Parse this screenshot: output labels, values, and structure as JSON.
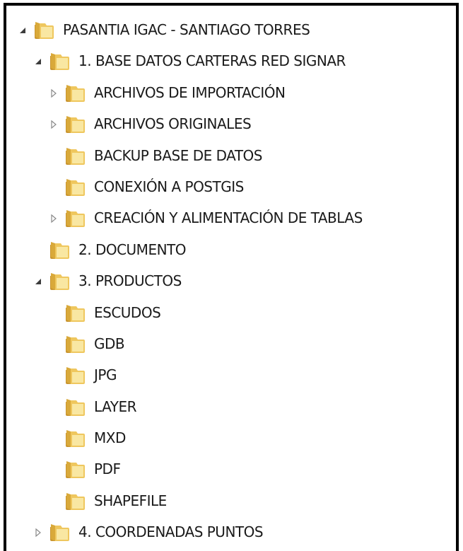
{
  "colors": {
    "folder_light": "#F9E7A2",
    "folder_mid": "#EFC75E",
    "folder_dark": "#D9A93A",
    "folder_tab": "#C99530",
    "expander_open": "#3C3C3C",
    "expander_closed": "#8A8A8A",
    "text": "#1A1A1A"
  },
  "tree": {
    "root": {
      "label": "PASANTIA IGAC - SANTIAGO TORRES",
      "expander": "expanded",
      "icon": "folder-icon"
    },
    "base_datos": {
      "label": "1. BASE DATOS CARTERAS RED SIGNAR",
      "expander": "expanded",
      "icon": "folder-icon",
      "children": [
        {
          "label": "ARCHIVOS DE IMPORTACIÓN",
          "expander": "collapsed",
          "icon": "folder-icon"
        },
        {
          "label": "ARCHIVOS ORIGINALES",
          "expander": "collapsed",
          "icon": "folder-icon"
        },
        {
          "label": "BACKUP BASE DE DATOS",
          "expander": "none",
          "icon": "folder-icon"
        },
        {
          "label": "CONEXIÓN A POSTGIS",
          "expander": "none",
          "icon": "folder-icon"
        },
        {
          "label": "CREACIÓN Y ALIMENTACIÓN DE TABLAS",
          "expander": "collapsed",
          "icon": "folder-icon"
        }
      ]
    },
    "documento": {
      "label": "2. DOCUMENTO",
      "expander": "none",
      "icon": "folder-icon"
    },
    "productos": {
      "label": "3. PRODUCTOS",
      "expander": "expanded",
      "icon": "folder-icon",
      "children": [
        {
          "label": "ESCUDOS",
          "expander": "none",
          "icon": "folder-icon"
        },
        {
          "label": "GDB",
          "expander": "none",
          "icon": "folder-icon"
        },
        {
          "label": "JPG",
          "expander": "none",
          "icon": "folder-icon"
        },
        {
          "label": "LAYER",
          "expander": "none",
          "icon": "folder-icon"
        },
        {
          "label": "MXD",
          "expander": "none",
          "icon": "folder-icon"
        },
        {
          "label": "PDF",
          "expander": "none",
          "icon": "folder-icon"
        },
        {
          "label": "SHAPEFILE",
          "expander": "none",
          "icon": "folder-icon"
        }
      ]
    },
    "coordenadas": {
      "label": "4. COORDENADAS PUNTOS",
      "expander": "collapsed",
      "icon": "folder-icon"
    }
  }
}
